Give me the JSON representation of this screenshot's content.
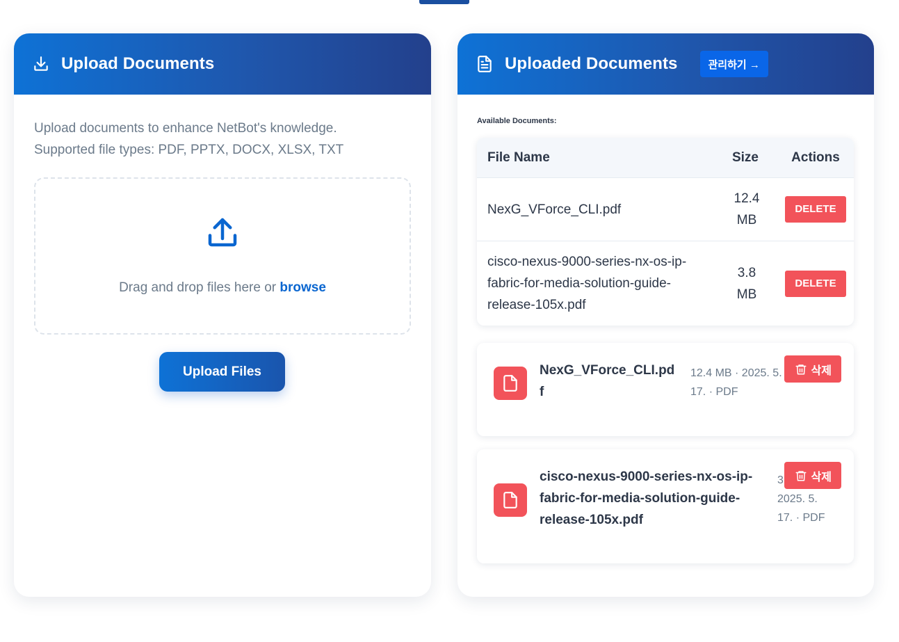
{
  "upload_panel": {
    "title": "Upload Documents",
    "header_icon": "download-icon",
    "description_line1": "Upload documents to enhance NetBot's knowledge.",
    "description_line2": "Supported file types: PDF, PPTX, DOCX, XLSX, TXT",
    "dropzone_icon": "upload-icon",
    "dropzone_text": "Drag and drop files here or",
    "browse_label": "browse",
    "upload_button": "Upload Files"
  },
  "documents_panel": {
    "title": "Uploaded Documents",
    "header_icon": "document-icon",
    "manage_button": "관리하기 →",
    "available_label": "Available Documents:",
    "table": {
      "columns": [
        "File Name",
        "Size",
        "Actions"
      ],
      "rows": [
        {
          "name": "NexG_VForce_CLI.pdf",
          "size_value": "12.4",
          "size_unit": "MB",
          "action": "DELETE"
        },
        {
          "name": "cisco-nexus-9000-series-nx-os-ip-fabric-for-media-solution-guide-release-105x.pdf",
          "size_value": "3.8",
          "size_unit": "MB",
          "action": "DELETE"
        }
      ]
    },
    "cards": [
      {
        "name": "NexG_VForce_CLI.pdf",
        "meta": "12.4 MB · 2025. 5. 17. · PDF",
        "delete_label": "삭제",
        "icon": "file-icon"
      },
      {
        "name": "cisco-nexus-9000-series-nx-os-ip-fabric-for-media-solution-guide-release-105x.pdf",
        "meta": "3.8 MB · 2025. 5. 17. · PDF",
        "delete_label": "삭제",
        "icon": "file-icon"
      }
    ]
  },
  "colors": {
    "header_gradient_start": "#0e72d6",
    "header_gradient_end": "#23408c",
    "danger": "#f2535a",
    "link": "#0a66d0"
  }
}
